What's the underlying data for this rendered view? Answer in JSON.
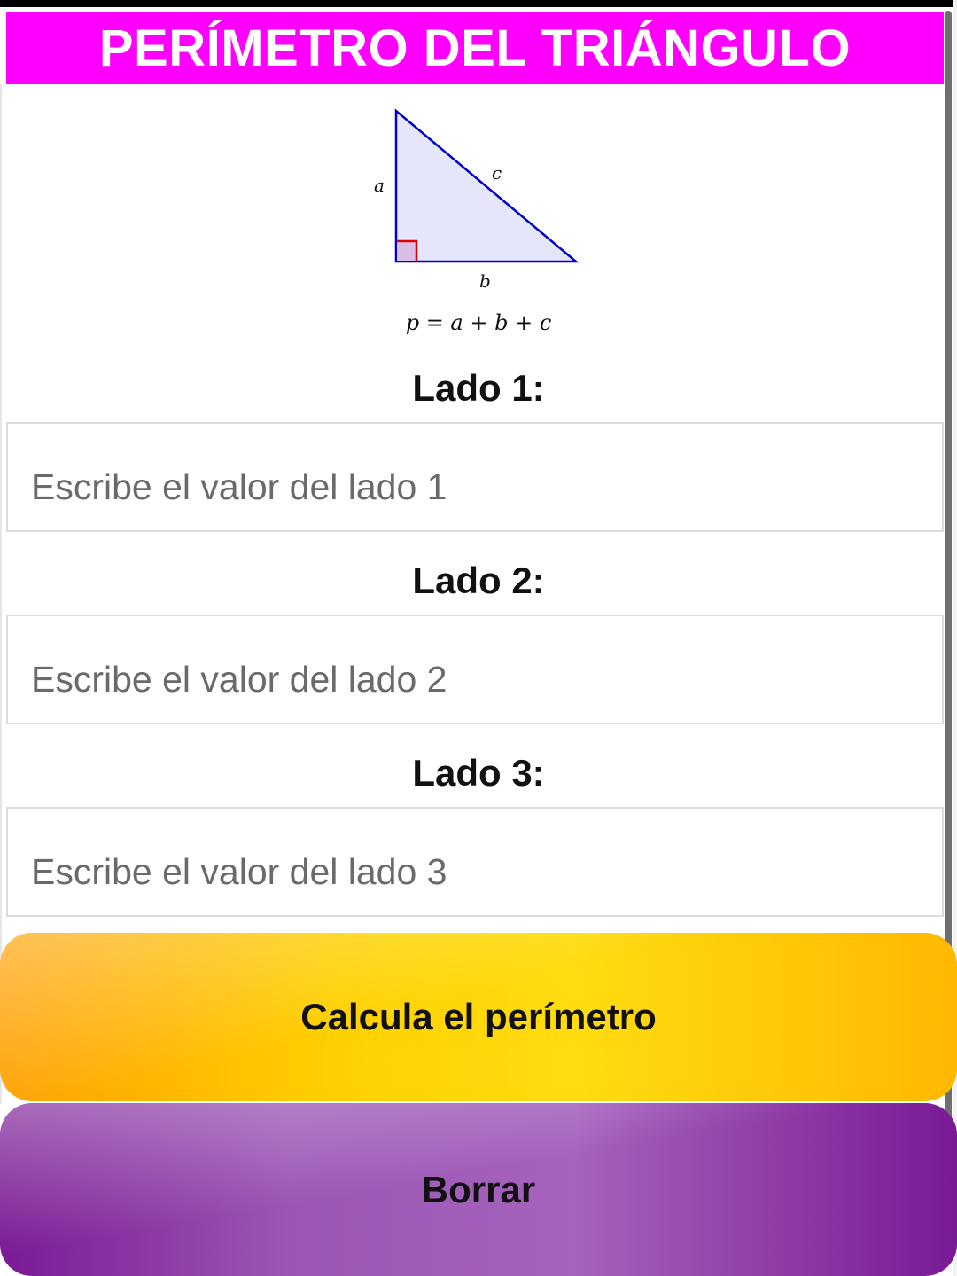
{
  "header": {
    "title": "PERÍMETRO DEL TRIÁNGULO"
  },
  "figure": {
    "labels": {
      "a": "a",
      "b": "b",
      "c": "c"
    },
    "formula": "p = a + b + c"
  },
  "fields": [
    {
      "label": "Lado 1:",
      "placeholder": "Escribe el valor del lado 1",
      "value": ""
    },
    {
      "label": "Lado 2:",
      "placeholder": "Escribe el valor del lado 2",
      "value": ""
    },
    {
      "label": "Lado 3:",
      "placeholder": "Escribe el valor del lado 3",
      "value": ""
    }
  ],
  "buttons": {
    "calculate": "Calcula el perímetro",
    "clear": "Borrar"
  },
  "colors": {
    "header_bg": "#ff00ff",
    "triangle_stroke": "#0000cc",
    "triangle_fill": "#e5e5fb",
    "right_angle": "#dd0000",
    "calculate_button": "#ffd000",
    "clear_button": "#9b56b5"
  }
}
